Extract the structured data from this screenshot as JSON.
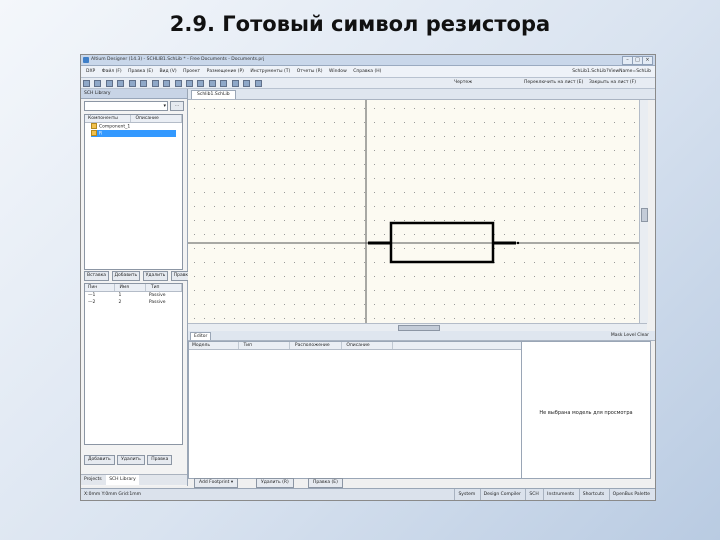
{
  "slide": {
    "title": "2.9. Готовый символ резистора"
  },
  "window": {
    "title": "Altium Designer (14.3) - SCHLIB1.SchLib * - Free Documents - Documents.prj"
  },
  "menu": [
    "DXP",
    "Файл (F)",
    "Правка (E)",
    "Вид (V)",
    "Проект",
    "Размещение (P)",
    "Инструменты (T)",
    "Отчеты (R)",
    "Window",
    "Справка (H)"
  ],
  "toolbar": {
    "right_path": "SchLib1.SchLib?ViewName=SchLib",
    "mode_label": "Чертеж",
    "hint1": "Переключить на лист (E)",
    "hint2": "Закрыть на лист (F)"
  },
  "left_panel": {
    "title": "SCH Library",
    "tree_columns": [
      "Компоненты",
      "Описание"
    ],
    "tree_items": [
      "Component_1",
      "R"
    ],
    "pin_buttons": [
      "Вставка",
      "Добавить",
      "Удалить",
      "Правка"
    ],
    "pin_columns": [
      "Пин",
      "Имя",
      "Тип"
    ],
    "pins": [
      {
        "pin": "1",
        "name": "1",
        "type": "Passive"
      },
      {
        "pin": "2",
        "name": "2",
        "type": "Passive"
      }
    ],
    "bottom_buttons": [
      "Добавить",
      "Удалить",
      "Правка"
    ],
    "tabs": [
      "Projects",
      "SCH Library"
    ]
  },
  "document": {
    "tab_label": "Schlib1.SchLib"
  },
  "editor": {
    "tab_label": "Editor",
    "right_label": "Mask Level  Clear",
    "columns": [
      "Модель",
      "Тип",
      "Расположение",
      "Описание"
    ],
    "preview_message": "Не выбрана модель для просмотра",
    "buttons": [
      "Add Footprint",
      "Удалить (R)",
      "Правка (E)"
    ]
  },
  "status": {
    "left": "X:0mm Y:0mm  Grid:1mm",
    "right": [
      "System",
      "Design Compiler",
      "SCH",
      "Instruments",
      "Shortcuts",
      "OpenBus Palette"
    ]
  },
  "colors": {
    "canvas_bg": "#fcfaf2",
    "grid_dot": "#9a9a9a",
    "resistor": "#000000",
    "selection": "#3399ff"
  }
}
